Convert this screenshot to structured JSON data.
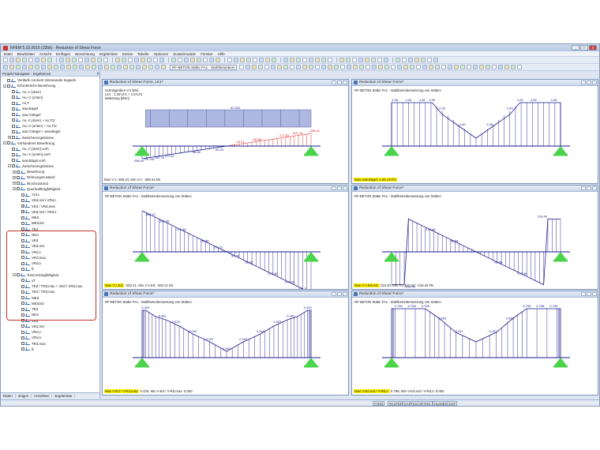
{
  "window": {
    "title": "RFEM 5.02.0016 (32bit) - Reduction of Shear Force",
    "min": "_",
    "max": "□",
    "close": "x"
  },
  "menu": [
    "Datei",
    "Bearbeiten",
    "Ansicht",
    "Einfügen",
    "Berechnung",
    "Ergebnisse",
    "Extras",
    "Tabelle",
    "Optionen",
    "Zusatzmodule",
    "Fenster",
    "Hilfe"
  ],
  "toolbar2": {
    "combo": "RF-BETON Stäbe FA1 - Stahlbetonbem"
  },
  "navigator": {
    "title": "Projekt-Navigator - Ergebnisse",
    "tabs": [
      "Daten",
      "Zeigen",
      "Ansichten",
      "Ergebnisse"
    ],
    "items": [
      {
        "indent": 0,
        "exp": "",
        "cb": "",
        "label": "Verläufe normiert miteinander koppeln"
      },
      {
        "indent": 0,
        "exp": "-",
        "cb": "",
        "label": "Erforderliche Bewehrung"
      },
      {
        "indent": 1,
        "exp": "",
        "cb": "",
        "label": "As,-z (oben)"
      },
      {
        "indent": 1,
        "exp": "",
        "cb": "",
        "label": "As,+z (unten)"
      },
      {
        "indent": 1,
        "exp": "",
        "cb": "",
        "label": "As,T"
      },
      {
        "indent": 1,
        "exp": "",
        "cb": "",
        "label": "asw,Bügel"
      },
      {
        "indent": 1,
        "exp": "",
        "cb": "",
        "label": "asw,T,Bügel"
      },
      {
        "indent": 1,
        "exp": "",
        "cb": "",
        "label": "As,-z (oben) + As,T/2"
      },
      {
        "indent": 1,
        "exp": "",
        "cb": "",
        "label": "As,+z (unten) + As,T/2"
      },
      {
        "indent": 1,
        "exp": "",
        "cb": "",
        "label": "asw,T,Bügel + asw,Bügel"
      },
      {
        "indent": 1,
        "exp": "+",
        "cb": "",
        "label": "Zwischenergebnisse"
      },
      {
        "indent": 0,
        "exp": "-",
        "cb": "",
        "label": "Vorhandene Bewehrung"
      },
      {
        "indent": 1,
        "exp": "",
        "cb": "",
        "label": "As,-z (oben),vorh"
      },
      {
        "indent": 1,
        "exp": "",
        "cb": "",
        "label": "As,+z (unten),vorh"
      },
      {
        "indent": 1,
        "exp": "",
        "cb": "",
        "label": "asw,Bügel,vorh"
      },
      {
        "indent": 1,
        "exp": "-",
        "cb": "",
        "label": "Zwischenergebnisse"
      },
      {
        "indent": 2,
        "exp": "+",
        "cb": "",
        "label": "Bewehrung"
      },
      {
        "indent": 2,
        "exp": "+",
        "cb": "",
        "label": "Dehnungszustand"
      },
      {
        "indent": 2,
        "exp": "+",
        "cb": "",
        "label": "Bruchzustand"
      },
      {
        "indent": 2,
        "exp": "-",
        "cb": "",
        "label": "Querkrafttragfähigkeit"
      },
      {
        "indent": 3,
        "exp": "",
        "cb": "",
        "label": "Yrd,c"
      },
      {
        "indent": 3,
        "exp": "",
        "cb": "",
        "label": "VEd,red / VRd,c"
      },
      {
        "indent": 3,
        "exp": "",
        "cb": "✓",
        "label": "VEd / VRd,max"
      },
      {
        "indent": 3,
        "exp": "",
        "cb": "✓",
        "label": "VEd,red / VRd,s"
      },
      {
        "indent": 3,
        "exp": "",
        "cb": "",
        "label": "MEd"
      },
      {
        "indent": 3,
        "exp": "",
        "cb": "",
        "label": "MEd,Ed"
      },
      {
        "indent": 3,
        "exp": "",
        "cb": "",
        "label": "TEd"
      },
      {
        "indent": 3,
        "exp": "",
        "cb": "",
        "label": "NEd"
      },
      {
        "indent": 3,
        "exp": "",
        "cb": "",
        "label": "VEd"
      },
      {
        "indent": 3,
        "exp": "",
        "cb": "",
        "label": "VEd,red"
      },
      {
        "indent": 3,
        "exp": "",
        "cb": "",
        "label": "VRd,c"
      },
      {
        "indent": 3,
        "exp": "",
        "cb": "",
        "label": "VRd,max"
      },
      {
        "indent": 3,
        "exp": "",
        "cb": "",
        "label": "VRd,s"
      },
      {
        "indent": 3,
        "exp": "",
        "cb": "",
        "label": "θ"
      },
      {
        "indent": 2,
        "exp": "-",
        "cb": "",
        "label": "Torsionstragfähigkeit"
      },
      {
        "indent": 3,
        "exp": "",
        "cb": "",
        "label": "γT"
      },
      {
        "indent": 3,
        "exp": "",
        "cb": "",
        "label": "TEd / TRd,max + VEd / VRd,max"
      },
      {
        "indent": 3,
        "exp": "",
        "cb": "",
        "label": "TEd / TRd,max"
      },
      {
        "indent": 3,
        "exp": "",
        "cb": "",
        "label": "MEd"
      },
      {
        "indent": 3,
        "exp": "",
        "cb": "",
        "label": "MEd,Ed"
      },
      {
        "indent": 3,
        "exp": "",
        "cb": "",
        "label": "TEd"
      },
      {
        "indent": 3,
        "exp": "",
        "cb": "",
        "label": "NEd"
      },
      {
        "indent": 3,
        "exp": "",
        "cb": "",
        "label": "VEd"
      },
      {
        "indent": 3,
        "exp": "",
        "cb": "",
        "label": "VEd,red"
      },
      {
        "indent": 3,
        "exp": "",
        "cb": "",
        "label": "VRd,c"
      },
      {
        "indent": 3,
        "exp": "",
        "cb": "",
        "label": "VRd,s"
      },
      {
        "indent": 3,
        "exp": "",
        "cb": "",
        "label": "TRd,max"
      },
      {
        "indent": 3,
        "exp": "",
        "cb": "",
        "label": "θ"
      }
    ]
  },
  "panes": [
    {
      "title": "Reduction of Shear Force, LK1*",
      "lines": [
        "Schnittgrößen V-z [kN]",
        "LK1 : 1.35*LF1 + 1.5*LF2",
        "Belastung [kNm]"
      ],
      "footer_pre": "Max V-z: 298.44, Min V-z: -298.44 kN",
      "footer_hl": ""
    },
    {
      "title": "Reduction of Shear Force*",
      "lines": [
        "RF-BETON Stäbe FA1 - Stahlbetonbemessung von Stäben"
      ],
      "footer_pre": "",
      "footer_hl": "Max asw,Bügel: 4.26 cm²/m"
    },
    {
      "title": "Reduction of Shear Force*",
      "lines": [
        "RF-BETON Stäbe FA1 - Stahlbetonbemessung von Stäben"
      ],
      "footer_pre": "-282.21, Min V-z,Ed: -282.21 kN",
      "footer_hl": "Max V-z,Ed:"
    },
    {
      "title": "Reduction of Shear Force*",
      "lines": [
        "RF-BETON Stäbe FA1 - Stahlbetonbemessung von Stäben"
      ],
      "footer_pre": "216.40, Min V-z,Ed,red: -216.40 kN",
      "footer_hl": "Max V-z,Ed,red:"
    },
    {
      "title": "Reduction of Shear Force*",
      "lines": [
        "RF-BETON Stäbe FA1 - Stahlbetonbemessung von Stäben"
      ],
      "footer_pre": "0.429, Min V-Ed / V-Rd,max: 0.000",
      "footer_hl": "Max V-Ed / V-Rd,max:"
    },
    {
      "title": "Reduction of Shear Force*",
      "lines": [
        "RF-BETON Stäbe FA1 - Stahlbetonbemessung von Stäben"
      ],
      "footer_pre": "0.798, Min V-Ed,red / V-Rd,s: 0.000",
      "footer_hl": "Max V-Ed,red / V-Rd,s:"
    }
  ],
  "diagrams": {
    "vz": {
      "labels": [
        "298.44",
        "237.86",
        "207.76",
        "177.52",
        "98.58",
        "59.23",
        "-29.11",
        "-98.58",
        "-177.52",
        "-207.76",
        "-298.44"
      ],
      "load": "92.500"
    },
    "asw": {
      "labels": [
        "4.26",
        "4.26",
        "4.26",
        "4.26",
        "2.40",
        "1.60",
        "1.60",
        "2.40",
        "4.26",
        "4.26",
        "4.26"
      ]
    },
    "ved": {
      "labels": [
        "-282.21",
        "-237.95",
        "-177.46",
        "-98.58",
        "-59.23",
        "59.23",
        "98.58",
        "177.46",
        "237.95",
        "282.21"
      ]
    },
    "vedred": {
      "labels": [
        "-216.40",
        "-177.46",
        "-98.58",
        "98.58",
        "177.46",
        "216.40"
      ]
    },
    "ratio1": {
      "labels": [
        "0.429",
        "0.381",
        "0.323",
        "0.244",
        "0.157",
        "0.057",
        "0.157",
        "0.244",
        "0.323",
        "0.381",
        "0.429"
      ]
    },
    "ratio2": {
      "labels": [
        "0.798",
        "0.798",
        "0.798",
        "0.653",
        "0.421",
        "0.421",
        "0.653",
        "0.798",
        "0.798",
        "0.798"
      ]
    }
  },
  "status": [
    "FANG",
    "RASTER",
    "KARTES",
    "OFANG",
    "HLINIEN",
    "DXF"
  ]
}
